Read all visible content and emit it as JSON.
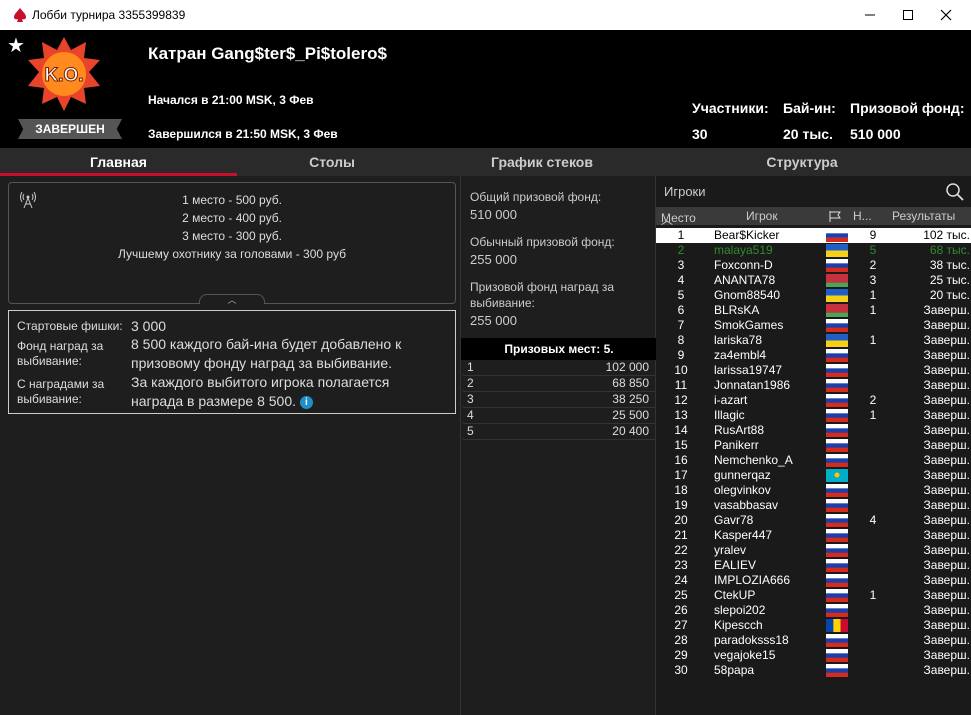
{
  "window": {
    "title": "Лобби турнира 3355399839"
  },
  "header": {
    "logo_text": "K.O.",
    "status": "ЗАВЕРШЕН",
    "name": "Катран Gang$ter$_Pi$tolero$",
    "started": "Начался в 21:00 MSK, 3 Фев",
    "finished": "Завершился в 21:50 MSK, 3 Фев",
    "stats": [
      {
        "label": "Участники:",
        "value": "30"
      },
      {
        "label": "Бай-ин:",
        "value": "20 тыс."
      },
      {
        "label": "Призовой фонд:",
        "value": "510 000"
      }
    ]
  },
  "tabs": [
    "Главная",
    "Столы",
    "График стеков",
    "Структура"
  ],
  "prizes": [
    "1 место - 500 руб.",
    "2 место - 400 руб.",
    "3 место - 300 руб.",
    "Лучшему охотнику за головами - 300 руб"
  ],
  "info": {
    "chips_label": "Стартовые фишки:",
    "chips_value": "3 000",
    "bounty_pool_label": "Фонд наград за выбивание:",
    "bounty_pool_value": "8 500 каждого бай-ина будет добавлено к призовому фонду наград за выбивание.",
    "bounty_label": "С наградами за выбивание:",
    "bounty_value": "За каждого выбитого игрока полагается награда в размере 8 500."
  },
  "pools": {
    "total_label": "Общий призовой фонд:",
    "total_value": "510 000",
    "regular_label": "Обычный призовой фонд:",
    "regular_value": "255 000",
    "bounty_label": "Призовой фонд наград за выбивание:",
    "bounty_value": "255 000"
  },
  "paid": {
    "header": "Призовых мест: 5.",
    "rows": [
      {
        "n": "1",
        "v": "102 000"
      },
      {
        "n": "2",
        "v": "68 850"
      },
      {
        "n": "3",
        "v": "38 250"
      },
      {
        "n": "4",
        "v": "25 500"
      },
      {
        "n": "5",
        "v": "20 400"
      }
    ]
  },
  "players": {
    "search_placeholder": "Игроки",
    "col_place": "Место",
    "col_player": "Игрок",
    "col_ko": "Н...",
    "col_results": "Результаты",
    "rows": [
      {
        "place": "1",
        "name": "Bear$Kicker",
        "flag": "ru",
        "ko": "9",
        "res": "102 тыс."
      },
      {
        "place": "2",
        "name": "malaya519",
        "flag": "ua",
        "ko": "5",
        "res": "68 тыс."
      },
      {
        "place": "3",
        "name": "Foxconn-D",
        "flag": "ru",
        "ko": "2",
        "res": "38 тыс."
      },
      {
        "place": "4",
        "name": "ANANTA78",
        "flag": "by",
        "ko": "3",
        "res": "25 тыс."
      },
      {
        "place": "5",
        "name": "Gnom88540",
        "flag": "ua",
        "ko": "1",
        "res": "20 тыс."
      },
      {
        "place": "6",
        "name": "BLRsKA",
        "flag": "by",
        "ko": "1",
        "res": "Заверш."
      },
      {
        "place": "7",
        "name": "SmokGames",
        "flag": "ru",
        "ko": "",
        "res": "Заверш."
      },
      {
        "place": "8",
        "name": "lariska78",
        "flag": "ua",
        "ko": "1",
        "res": "Заверш."
      },
      {
        "place": "9",
        "name": "za4embl4",
        "flag": "ru",
        "ko": "",
        "res": "Заверш."
      },
      {
        "place": "10",
        "name": "larissa19747",
        "flag": "ru",
        "ko": "",
        "res": "Заверш."
      },
      {
        "place": "11",
        "name": "Jonnatan1986",
        "flag": "ru",
        "ko": "",
        "res": "Заверш."
      },
      {
        "place": "12",
        "name": "i-azart",
        "flag": "ru",
        "ko": "2",
        "res": "Заверш."
      },
      {
        "place": "13",
        "name": "Illagic",
        "flag": "ru",
        "ko": "1",
        "res": "Заверш."
      },
      {
        "place": "14",
        "name": "RusArt88",
        "flag": "ru",
        "ko": "",
        "res": "Заверш."
      },
      {
        "place": "15",
        "name": "Panikerr",
        "flag": "ru",
        "ko": "",
        "res": "Заверш."
      },
      {
        "place": "16",
        "name": "Nemchenko_A",
        "flag": "ru",
        "ko": "",
        "res": "Заверш."
      },
      {
        "place": "17",
        "name": "gunnerqaz",
        "flag": "kz",
        "ko": "",
        "res": "Заверш."
      },
      {
        "place": "18",
        "name": "olegvinkov",
        "flag": "ru",
        "ko": "",
        "res": "Заверш."
      },
      {
        "place": "19",
        "name": "vasabbasav",
        "flag": "ru",
        "ko": "",
        "res": "Заверш."
      },
      {
        "place": "20",
        "name": "Gavr78",
        "flag": "ru",
        "ko": "4",
        "res": "Заверш."
      },
      {
        "place": "21",
        "name": "Kasper447",
        "flag": "ru",
        "ko": "",
        "res": "Заверш."
      },
      {
        "place": "22",
        "name": "yralev",
        "flag": "ru",
        "ko": "",
        "res": "Заверш."
      },
      {
        "place": "23",
        "name": "EALIEV",
        "flag": "ru",
        "ko": "",
        "res": "Заверш."
      },
      {
        "place": "24",
        "name": "IMPLOZIA666",
        "flag": "ru",
        "ko": "",
        "res": "Заверш."
      },
      {
        "place": "25",
        "name": "CtekUP",
        "flag": "ru",
        "ko": "1",
        "res": "Заверш."
      },
      {
        "place": "26",
        "name": "slepoi202",
        "flag": "ru",
        "ko": "",
        "res": "Заверш."
      },
      {
        "place": "27",
        "name": "Kipescch",
        "flag": "md",
        "ko": "",
        "res": "Заверш."
      },
      {
        "place": "28",
        "name": "paradoksss18",
        "flag": "ru",
        "ko": "",
        "res": "Заверш."
      },
      {
        "place": "29",
        "name": "vegajoke15",
        "flag": "ru",
        "ko": "",
        "res": "Заверш."
      },
      {
        "place": "30",
        "name": "58papa",
        "flag": "ru",
        "ko": "",
        "res": "Заверш."
      }
    ]
  },
  "colors": {
    "accent": "#c8102e",
    "highlight_row": "#2e8b2e",
    "info_icon": "#1e90c8"
  }
}
